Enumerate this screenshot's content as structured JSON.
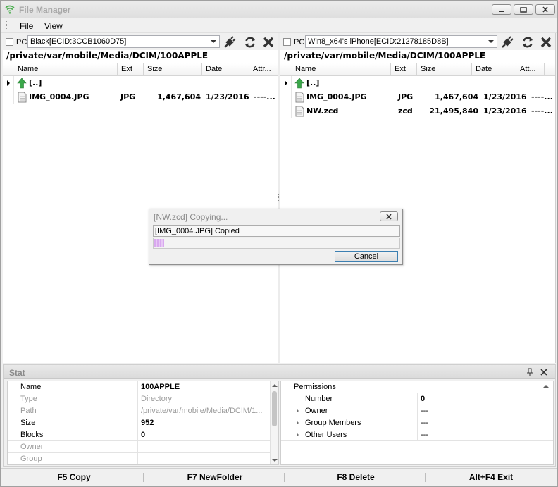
{
  "window": {
    "title": "File Manager",
    "brand_color": "#4caf50"
  },
  "menu": [
    {
      "label": "File"
    },
    {
      "label": "View"
    }
  ],
  "panels": {
    "left": {
      "pc_label": "PC",
      "device": "Black[ECID:3CCB1060D75]",
      "path": "/private/var/mobile/Media/DCIM/100APPLE",
      "columns": [
        "Name",
        "Ext",
        "Size",
        "Date",
        "Attr..."
      ],
      "parent_label": "[..]",
      "files": [
        {
          "name": "IMG_0004.JPG",
          "ext": "JPG",
          "size": "1,467,604",
          "date": "1/23/2016",
          "attr": "----..."
        }
      ]
    },
    "right": {
      "pc_label": "PC",
      "device": "Win8_x64's iPhone[ECID:21278185D8B]",
      "path": "/private/var/mobile/Media/DCIM/100APPLE",
      "columns": [
        "Name",
        "Ext",
        "Size",
        "Date",
        "Att..."
      ],
      "parent_label": "[..]",
      "files": [
        {
          "name": "IMG_0004.JPG",
          "ext": "JPG",
          "size": "1,467,604",
          "date": "1/23/2016",
          "attr": "----..."
        },
        {
          "name": "NW.zcd",
          "ext": "zcd",
          "size": "21,495,840",
          "date": "1/23/2016",
          "attr": "----..."
        }
      ]
    }
  },
  "dialog": {
    "title": "[NW.zcd] Copying...",
    "status": "[IMG_0004.JPG] Copied",
    "progress_percent": 4,
    "cancel_label": "Cancel"
  },
  "stat": {
    "title": "Stat",
    "properties": [
      {
        "key": "Name",
        "value": "100APPLE",
        "enabled": true
      },
      {
        "key": "Type",
        "value": "Directory",
        "enabled": false
      },
      {
        "key": "Path",
        "value": "/private/var/mobile/Media/DCIM/1...",
        "enabled": false
      },
      {
        "key": "Size",
        "value": "952",
        "enabled": true
      },
      {
        "key": "Blocks",
        "value": "0",
        "enabled": true
      },
      {
        "key": "Owner",
        "value": "",
        "enabled": false
      },
      {
        "key": "Group",
        "value": "",
        "enabled": false
      }
    ],
    "permissions": {
      "category": "Permissions",
      "items": [
        {
          "key": "Number",
          "value": "0",
          "expandable": false
        },
        {
          "key": "Owner",
          "value": "---",
          "expandable": true
        },
        {
          "key": "Group Members",
          "value": "---",
          "expandable": true
        },
        {
          "key": "Other Users",
          "value": "---",
          "expandable": true
        }
      ]
    }
  },
  "function_bar": [
    {
      "label": "F5 Copy"
    },
    {
      "label": "F7 NewFolder"
    },
    {
      "label": "F8 Delete"
    },
    {
      "label": "Alt+F4 Exit"
    }
  ]
}
